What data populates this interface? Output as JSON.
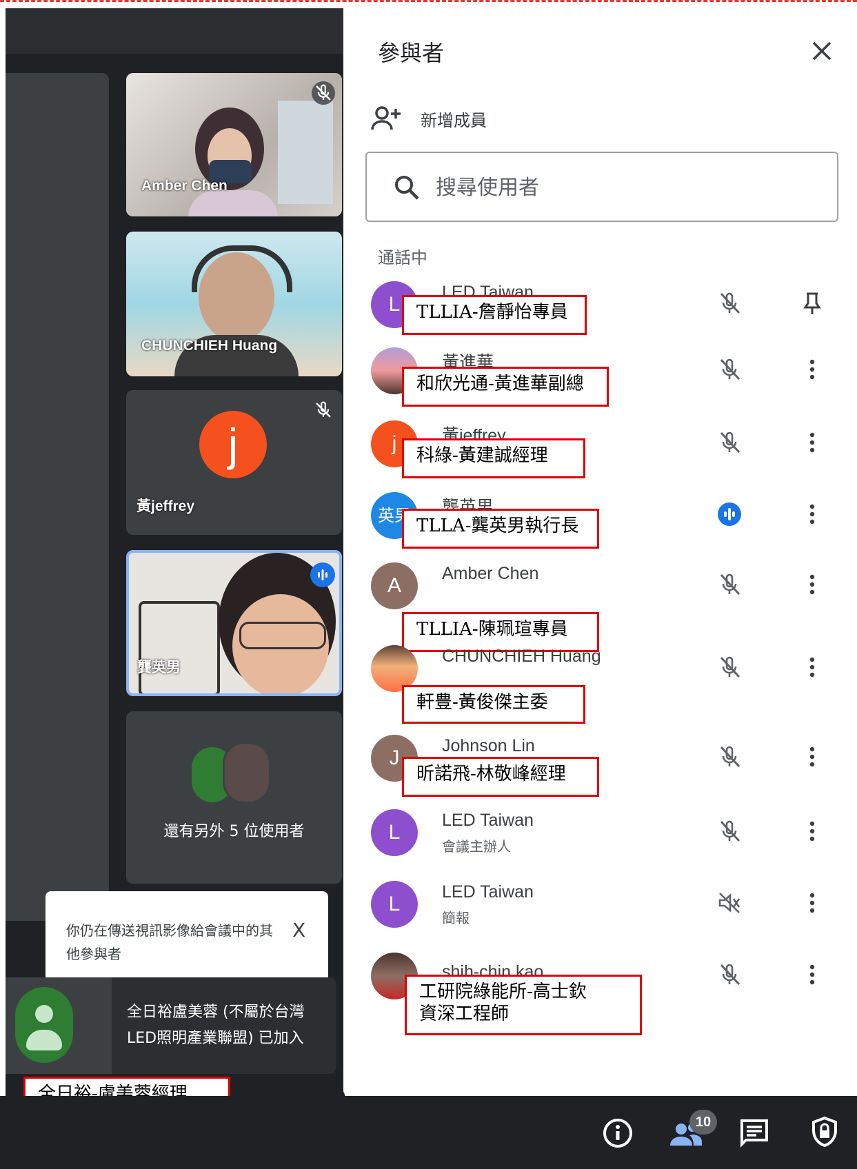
{
  "panel": {
    "title": "參與者",
    "add_member_label": "新增成員",
    "search_placeholder": "搜尋使用者",
    "section_label": "通話中"
  },
  "participants": [
    {
      "name": "LED Taiwan",
      "subtitle": "",
      "avatar_letter": "L",
      "avatar_color": "#8e4fcf",
      "mic": "muted",
      "action": "pin",
      "annotation": "TLLIA-詹靜怡專員"
    },
    {
      "name": "黃進華",
      "subtitle": "",
      "avatar_letter": "",
      "avatar_color": "#6a5a6e",
      "mic": "muted",
      "action": "more",
      "annotation": "和欣光通-黃進華副總"
    },
    {
      "name": "黃jeffrey",
      "subtitle": "",
      "avatar_letter": "j",
      "avatar_color": "#f4511e",
      "mic": "muted",
      "action": "more",
      "annotation": "科綠-黃建誠經理"
    },
    {
      "name": "龔英男",
      "subtitle": "",
      "avatar_letter": "英男",
      "avatar_color": "#1e88e5",
      "mic": "speaking",
      "action": "more",
      "annotation": "TLLA-龔英男執行長"
    },
    {
      "name": "Amber Chen",
      "subtitle": "",
      "avatar_letter": "A",
      "avatar_color": "#8d6e63",
      "mic": "muted",
      "action": "more",
      "annotation": "TLLIA-陳珮瑄專員"
    },
    {
      "name": "CHUNCHIEH Huang",
      "subtitle": "",
      "avatar_letter": "",
      "avatar_color": "#c77d3a",
      "mic": "muted",
      "action": "more",
      "annotation": "軒豊-黃俊傑主委"
    },
    {
      "name": "Johnson Lin",
      "subtitle": "",
      "avatar_letter": "J",
      "avatar_color": "#8d6e63",
      "mic": "muted",
      "action": "more",
      "annotation": "昕諾飛-林敬峰經理"
    },
    {
      "name": "LED Taiwan",
      "subtitle": "會議主辦人",
      "avatar_letter": "L",
      "avatar_color": "#8e4fcf",
      "mic": "muted",
      "action": "more",
      "annotation": ""
    },
    {
      "name": "LED Taiwan",
      "subtitle": "簡報",
      "avatar_letter": "L",
      "avatar_color": "#8e4fcf",
      "mic": "presenting-muted",
      "action": "more",
      "annotation": ""
    },
    {
      "name": "shih-chin kao",
      "subtitle": "",
      "avatar_letter": "",
      "avatar_color": "#5a4a4a",
      "mic": "muted",
      "action": "more",
      "annotation": "工研院綠能所-高士欽\n資深工程師"
    }
  ],
  "tiles": [
    {
      "name": "Amber Chen",
      "mic": "muted"
    },
    {
      "name": "CHUNCHIEH Huang",
      "mic": ""
    },
    {
      "name": "黃jeffrey",
      "mic": "muted",
      "avatar_letter": "j"
    },
    {
      "name": "龔英男",
      "mic": "speaking"
    },
    {
      "name": "還有另外 5 位使用者",
      "mic": ""
    }
  ],
  "toast": {
    "text": "你仍在傳送視訊影像給會議中的其他參與者",
    "close": "X"
  },
  "join_notice": {
    "text": "全日裕盧美蓉 (不屬於台灣LED照明產業聯盟) 已加入",
    "annotation": "全日裕-盧美蓉經理"
  },
  "bottom_bar": {
    "participant_count": "10",
    "icons": [
      "info-icon",
      "people-icon",
      "chat-icon",
      "lock-shield-icon"
    ]
  },
  "colors": {
    "annotation_border": "#e00000",
    "meet_background": "#202124",
    "speaking_blue": "#1a73e8"
  }
}
